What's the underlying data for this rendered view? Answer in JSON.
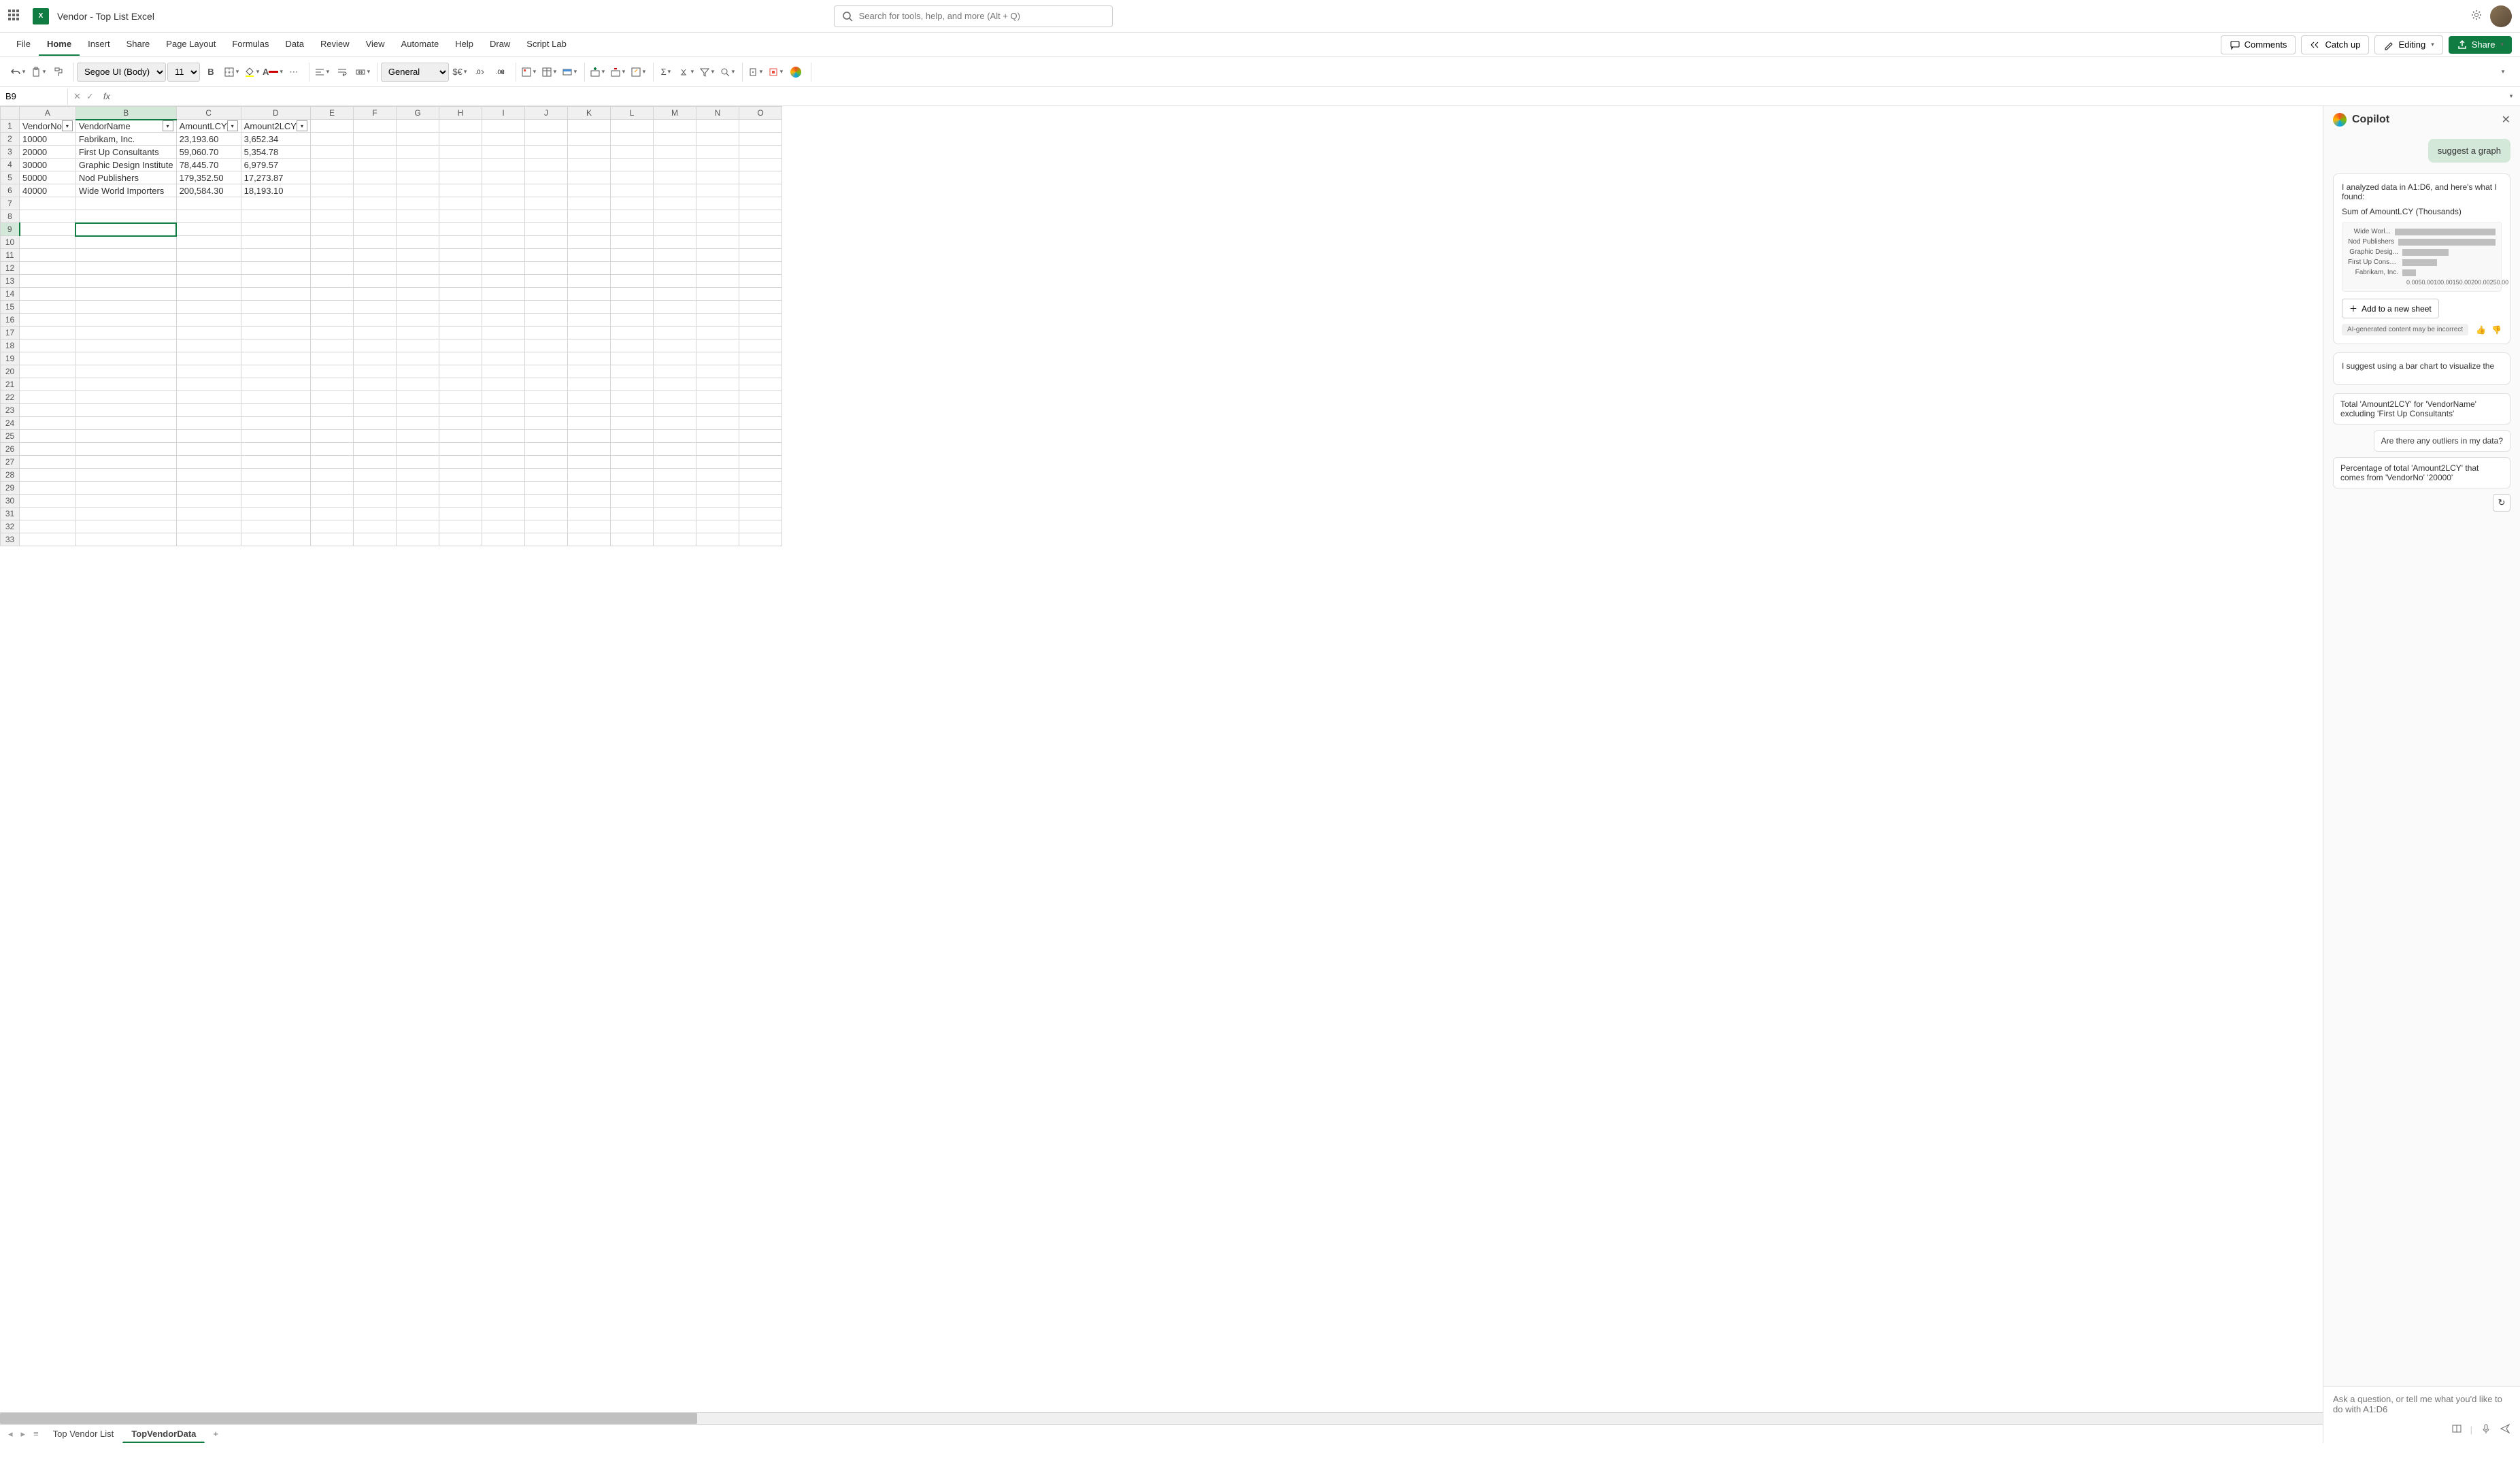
{
  "titlebar": {
    "doc_title": "Vendor - Top List Excel",
    "search_placeholder": "Search for tools, help, and more (Alt + Q)"
  },
  "menubar": {
    "items": [
      "File",
      "Home",
      "Insert",
      "Share",
      "Page Layout",
      "Formulas",
      "Data",
      "Review",
      "View",
      "Automate",
      "Help",
      "Draw",
      "Script Lab"
    ],
    "active": "Home",
    "actions": {
      "comments": "Comments",
      "catchup": "Catch up",
      "editing": "Editing",
      "share": "Share"
    }
  },
  "ribbon": {
    "font": "Segoe UI (Body)",
    "size": "11",
    "number_format": "General"
  },
  "namebox": "B9",
  "columns": [
    "A",
    "B",
    "C",
    "D",
    "E",
    "F",
    "G",
    "H",
    "I",
    "J",
    "K",
    "L",
    "M",
    "N",
    "O"
  ],
  "headers": {
    "A": "VendorNo",
    "B": "VendorName",
    "C": "AmountLCY",
    "D": "Amount2LCY"
  },
  "rows": [
    {
      "A": "10000",
      "B": "Fabrikam, Inc.",
      "C": "23,193.60",
      "D": "3,652.34"
    },
    {
      "A": "20000",
      "B": "First Up Consultants",
      "C": "59,060.70",
      "D": "5,354.78"
    },
    {
      "A": "30000",
      "B": "Graphic Design Institute",
      "C": "78,445.70",
      "D": "6,979.57"
    },
    {
      "A": "50000",
      "B": "Nod Publishers",
      "C": "179,352.50",
      "D": "17,273.87"
    },
    {
      "A": "40000",
      "B": "Wide World Importers",
      "C": "200,584.30",
      "D": "18,193.10"
    }
  ],
  "sheets": {
    "tabs": [
      "Top Vendor List",
      "TopVendorData"
    ],
    "active": "TopVendorData"
  },
  "copilot": {
    "title": "Copilot",
    "user_message": "suggest a graph",
    "analysis_intro": "I analyzed data in A1:D6, and here's what I found:",
    "chart_title": "Sum of AmountLCY (Thousands)",
    "add_sheet": "Add to a new sheet",
    "disclaimer": "AI-generated content may be incorrect",
    "suggestion_text": "I suggest using a bar chart to visualize the",
    "chips": [
      "Total 'Amount2LCY' for 'VendorName' excluding 'First Up Consultants'",
      "Are there any outliers in my data?",
      "Percentage of total 'Amount2LCY' that comes from 'VendorNo' '20000'"
    ],
    "input_placeholder": "Ask a question, or tell me what you'd like to do with A1:D6"
  },
  "chart_data": {
    "type": "bar",
    "orientation": "horizontal",
    "title": "Sum of AmountLCY (Thousands)",
    "categories": [
      "Wide Worl...",
      "Nod Publishers",
      "Graphic Desig...",
      "First Up Consultants",
      "Fabrikam, Inc."
    ],
    "values": [
      200.58,
      179.35,
      78.45,
      59.06,
      23.19
    ],
    "xlim": [
      0,
      250
    ],
    "xticks": [
      "0.00",
      "50.00",
      "100.00",
      "150.00",
      "200.00",
      "250.00"
    ],
    "xlabel": "",
    "ylabel": ""
  }
}
